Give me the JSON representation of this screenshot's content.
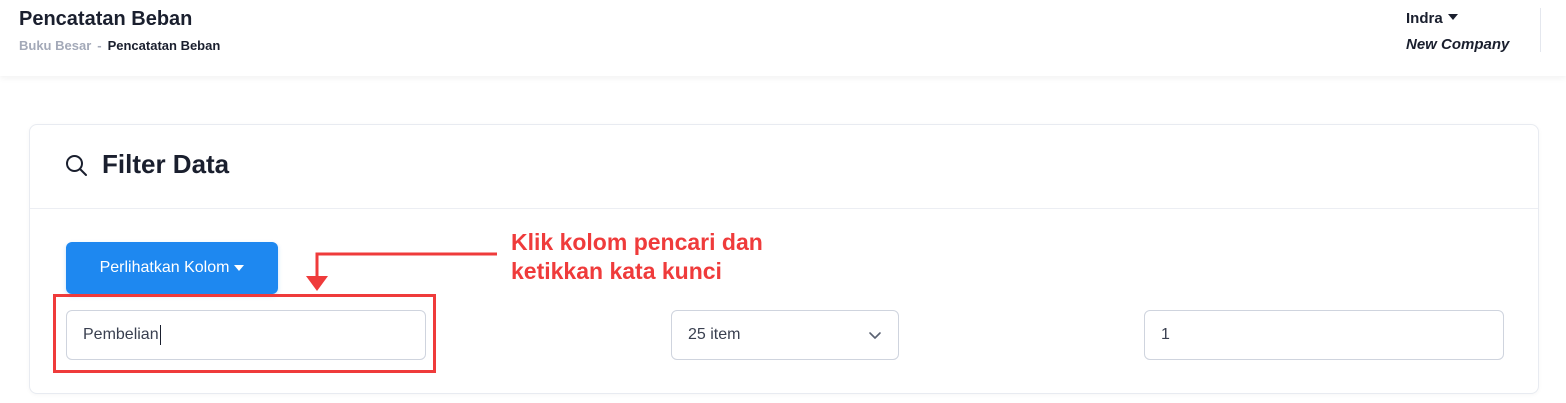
{
  "header": {
    "title": "Pencatatan Beban",
    "breadcrumb": {
      "parent": "Buku Besar",
      "separator": "-",
      "current": "Pencatatan Beban"
    },
    "user": {
      "name": "Indra",
      "company": "New Company"
    }
  },
  "filter": {
    "title": "Filter Data",
    "show_columns_button": "Perlihatkan Kolom",
    "search_value": "Pembelian",
    "per_page_selected": "25 item",
    "page_number": "1"
  },
  "annotation": {
    "line1": "Klik kolom pencari dan",
    "line2": "ketikkan kata kunci",
    "color": "#ef3b3b"
  },
  "colors": {
    "primary": "#1e88f0",
    "annotation": "#ef3b3b"
  },
  "icons": {
    "title": "search-icon",
    "dropdown": "chevron-down-icon",
    "menu_caret": "caret-down-icon"
  }
}
